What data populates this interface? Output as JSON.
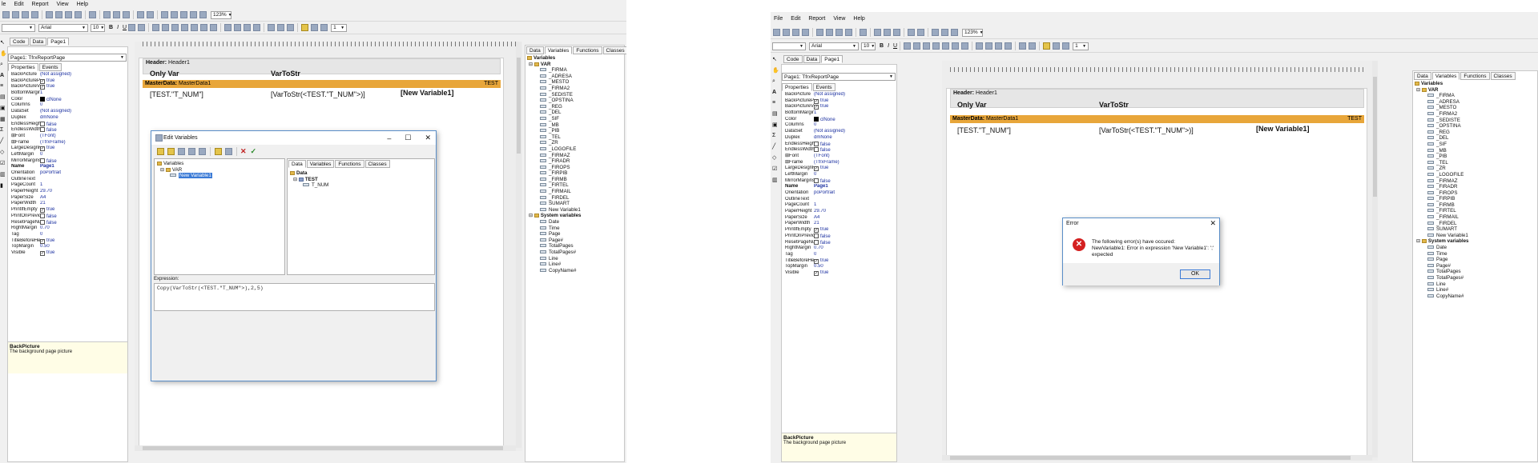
{
  "menu": [
    "File",
    "Edit",
    "Report",
    "View",
    "Help"
  ],
  "left_menu": [
    "le",
    "Edit",
    "Report",
    "View",
    "Help"
  ],
  "zoom": "123%",
  "font_name": "Arial",
  "font_size": "10",
  "line_width": "1",
  "tabs": [
    "Code",
    "Data",
    "Page1"
  ],
  "page_combo": "Page1: TfrxReportPage",
  "prop_tabs": [
    "Properties",
    "Events"
  ],
  "properties": [
    {
      "k": "BackPicture",
      "v": "(Not assigned)"
    },
    {
      "k": "BackPictureP",
      "v": "true",
      "cb": true
    },
    {
      "k": "BackPictureV",
      "v": "true",
      "cb": true
    },
    {
      "k": "BottomMargin",
      "v": "1"
    },
    {
      "k": "Color",
      "v": "clNone",
      "sw": true
    },
    {
      "k": "Columns",
      "v": "0"
    },
    {
      "k": "DataSet",
      "v": "(Not assigned)"
    },
    {
      "k": "Duplex",
      "v": "dmNone"
    },
    {
      "k": "EndlessHeigh",
      "v": "false",
      "cb": true
    },
    {
      "k": "EndlessWidth",
      "v": "false",
      "cb": true
    },
    {
      "k": "⊞Font",
      "v": "(TFont)"
    },
    {
      "k": "⊞Frame",
      "v": "(TfrxFrame)"
    },
    {
      "k": "LargeDesignH",
      "v": "true",
      "cb": true
    },
    {
      "k": "LeftMargin",
      "v": "0"
    },
    {
      "k": "MirrorMargins",
      "v": "false",
      "cb": true
    },
    {
      "k": "Name",
      "v": "Page1",
      "b": true
    },
    {
      "k": "Orientation",
      "v": "poPortrait"
    },
    {
      "k": "OutlineText",
      "v": ""
    },
    {
      "k": "PageCount",
      "v": "1"
    },
    {
      "k": "PaperHeight",
      "v": "29.70"
    },
    {
      "k": "PaperSize",
      "v": "A4"
    },
    {
      "k": "PaperWidth",
      "v": "21"
    },
    {
      "k": "PrintIfEmpty",
      "v": "true",
      "cb": true
    },
    {
      "k": "PrintOnPrevio",
      "v": "false",
      "cb": true
    },
    {
      "k": "ResetPageNu",
      "v": "false",
      "cb": true
    },
    {
      "k": "RightMargin",
      "v": "0.70"
    },
    {
      "k": "Tag",
      "v": "0"
    },
    {
      "k": "TitleBeforeHe",
      "v": "true",
      "cb": true
    },
    {
      "k": "TopMargin",
      "v": "0.50"
    },
    {
      "k": "Visible",
      "v": "true",
      "cb": true
    }
  ],
  "props_right": [
    {
      "k": "BackPicture",
      "v": "(Not assigned)"
    },
    {
      "k": "BackPictureP",
      "v": "true",
      "cb": true
    },
    {
      "k": "BackPictureV",
      "v": "true",
      "cb": true
    },
    {
      "k": "BottomMargin",
      "v": "1"
    },
    {
      "k": "Color",
      "v": "clNone",
      "sw": true
    },
    {
      "k": "Columns",
      "v": "0"
    },
    {
      "k": "DataSet",
      "v": "(Not assigned)"
    },
    {
      "k": "Duplex",
      "v": "dmNone"
    },
    {
      "k": "EndlessHeigh",
      "v": "false",
      "cb": true
    },
    {
      "k": "EndlessWidth",
      "v": "false",
      "cb": true
    },
    {
      "k": "⊞Font",
      "v": "(TFont)"
    },
    {
      "k": "⊞Frame",
      "v": "(TfrxFrame)"
    },
    {
      "k": "LargeDesignH",
      "v": "true",
      "cb": true
    },
    {
      "k": "LeftMargin",
      "v": "0"
    },
    {
      "k": "MirrorMargins",
      "v": "false",
      "cb": true
    },
    {
      "k": "Name",
      "v": "Page1",
      "b": true
    },
    {
      "k": "Orientation",
      "v": "poPortrait"
    },
    {
      "k": "OutlineText",
      "v": ""
    },
    {
      "k": "PageCount",
      "v": "1"
    },
    {
      "k": "PaperHeight",
      "v": "29.70"
    },
    {
      "k": "PaperSize",
      "v": "A4"
    },
    {
      "k": "PaperWidth",
      "v": "21"
    },
    {
      "k": "PrintIfEmpty",
      "v": "true",
      "cb": true
    },
    {
      "k": "PrintOnPrevio",
      "v": "false",
      "cb": true
    },
    {
      "k": "ResetPageNu",
      "v": "false",
      "cb": true
    },
    {
      "k": "RightMargin",
      "v": "0.70"
    },
    {
      "k": "Tag",
      "v": "0"
    },
    {
      "k": "TitleBeforeHe",
      "v": "true",
      "cb": true
    },
    {
      "k": "TopMargin",
      "v": "0.50"
    },
    {
      "k": "Visible",
      "v": "true",
      "cb": true
    }
  ],
  "help_title": "BackPicture",
  "help_text": "The background page picture",
  "header_band": "Header:",
  "header_name": "Header1",
  "masterdata_band": "MasterData:",
  "masterdata_name": "MasterData1",
  "dataset_tag": "TEST",
  "cells": {
    "only_var": "Only Var",
    "vartostr": "VarToStr",
    "test_num": "[TEST.\"T_NUM\"]",
    "vartostr_expr": "[VarToStr(<TEST.\"T_NUM\">)]",
    "new_var": "[New Variable1]"
  },
  "right_tabs": [
    "Data",
    "Variables",
    "Functions",
    "Classes"
  ],
  "vars_root": "Variables",
  "var_group": "VAR",
  "var_items": [
    "_FIRMA",
    "_ADRESA",
    "_MESTO",
    "_FIRMA2",
    "_SEDISTE",
    "_OPSTINA",
    "_REG",
    "_DEL",
    "_SIF",
    "_MB",
    "_PIB",
    "_TEL",
    "_ZR",
    "_LOGOFILE",
    "_FIRMAZ",
    "_FIRADR",
    "_FIROPS",
    "_FIRPIB",
    "_FIRMB",
    "_FIRTEL",
    "_FIRMAIL",
    "_FIRDEL",
    "SUMART",
    "New Variable1"
  ],
  "sys_group": "System variables",
  "sys_items": [
    "Date",
    "Time",
    "Page",
    "Page#",
    "TotalPages",
    "TotalPages#",
    "Line",
    "Line#",
    "CopyName#"
  ],
  "edit_vars": {
    "title": "Edit Variables",
    "tree_root": "Variables",
    "tree_group": "VAR",
    "tree_item": "New Variable1",
    "tabs": [
      "Data",
      "Variables",
      "Functions",
      "Classes"
    ],
    "data_root": "Data",
    "data_ds": "TEST",
    "data_field": "T_NUM",
    "expr_label": "Expression:",
    "expr_value": "Copy(VarToStr(<TEST.\"T_NUM\">),2,5)"
  },
  "error_dialog": {
    "title": "Error",
    "line1": "The following error(s) have occured:",
    "line2": "NewVariable1: Error in expression 'New Variable1': ';' expected",
    "ok": "OK"
  }
}
